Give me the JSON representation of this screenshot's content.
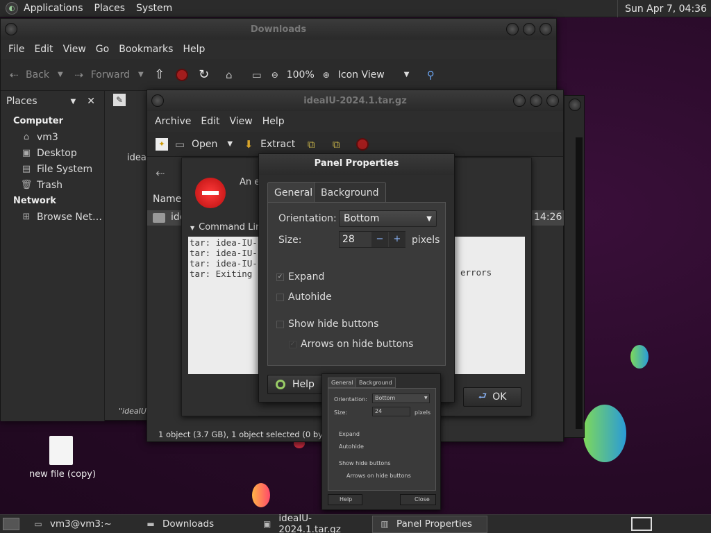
{
  "top_panel": {
    "menus": [
      "Applications",
      "Places",
      "System"
    ],
    "clock": "Sun Apr  7, 04:36"
  },
  "downloads": {
    "title": "Downloads",
    "menus": [
      "File",
      "Edit",
      "View",
      "Go",
      "Bookmarks",
      "Help"
    ],
    "toolbar": {
      "back": "Back",
      "forward": "Forward",
      "zoom": "100%",
      "view_mode": "Icon View"
    },
    "places_label": "Places",
    "sidebar": {
      "computer": "Computer",
      "computer_items": [
        "vm3",
        "Desktop",
        "File System",
        "Trash"
      ],
      "network": "Network",
      "network_items": [
        "Browse Net…"
      ]
    },
    "file_stub": "idea-",
    "status_stub": "\"ideaIU-"
  },
  "archive": {
    "title": "ideaIU-2024.1.tar.gz",
    "menus": [
      "Archive",
      "Edit",
      "View",
      "Help"
    ],
    "toolbar": {
      "open": "Open",
      "extract": "Extract"
    },
    "column_name": "Name",
    "row_name": "ide",
    "row_time": "14:26",
    "status": "1 object (3.7 GB), 1 object selected (0 bytes)"
  },
  "error_dialog": {
    "message_stub": "An e",
    "command_line_label": "Command Lin",
    "lines": [
      "tar: idea-IU-",
      "tar: idea-IU-",
      "tar: idea-IU-",
      "tar: Exiting"
    ],
    "trailing": "errors",
    "ok_label": "OK"
  },
  "panel_properties": {
    "title": "Panel Properties",
    "tabs": [
      "General",
      "Background"
    ],
    "orientation_label": "Orientation:",
    "orientation_value": "Bottom",
    "size_label": "Size:",
    "size_value": "28",
    "size_unit": "pixels",
    "expand": "Expand",
    "autohide": "Autohide",
    "show_hide_buttons": "Show hide buttons",
    "arrows_on_hide": "Arrows on hide buttons",
    "help_label": "Help"
  },
  "thumbnail": {
    "tabs": [
      "General",
      "Background"
    ],
    "orientation_label": "Orientation:",
    "orientation_value": "Bottom",
    "size_label": "Size:",
    "size_value": "24",
    "size_unit": "pixels",
    "expand": "Expand",
    "autohide": "Autohide",
    "show_hide_buttons": "Show hide buttons",
    "arrows_on_hide": "Arrows on hide buttons",
    "help_label": "Help",
    "close_label": "Close"
  },
  "desktop": {
    "icon_label": "new file (copy)"
  },
  "taskbar": {
    "items": [
      "vm3@vm3:~",
      "Downloads",
      "ideaIU-2024.1.tar.gz",
      "Panel Properties"
    ]
  }
}
